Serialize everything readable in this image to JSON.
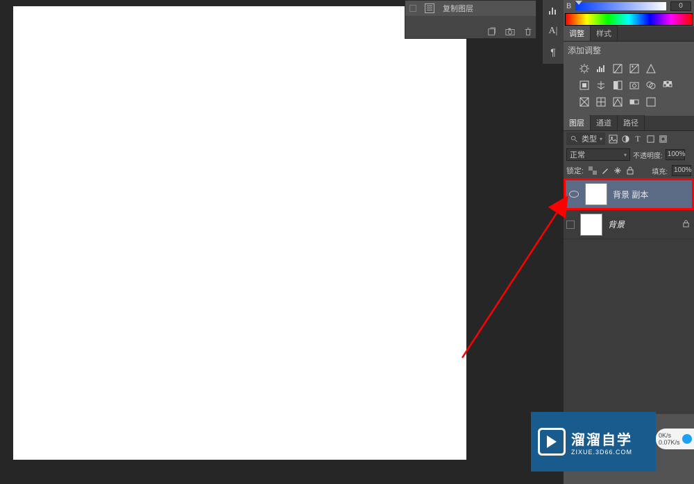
{
  "history": {
    "item_label": "复制图层"
  },
  "color": {
    "channel_label": "B",
    "value": "0"
  },
  "tabs_adjust": {
    "t1": "调整",
    "t2": "样式"
  },
  "adjustments": {
    "title": "添加调整"
  },
  "tabs_layers": {
    "t1": "图层",
    "t2": "通道",
    "t3": "路径"
  },
  "layer_filter": {
    "type_label": "类型"
  },
  "blend": {
    "mode": "正常",
    "opacity_label": "不透明度:",
    "opacity_value": "100%",
    "lock_label": "锁定:",
    "fill_label": "填充:",
    "fill_value": "100%"
  },
  "layers": {
    "item1_name": "背景 副本",
    "item2_name": "背景"
  },
  "watermark": {
    "big": "溜溜自学",
    "small": "ZIXUE.3D66.COM"
  },
  "speed": {
    "line1": "0K/s",
    "line2": "0.07K/s"
  }
}
